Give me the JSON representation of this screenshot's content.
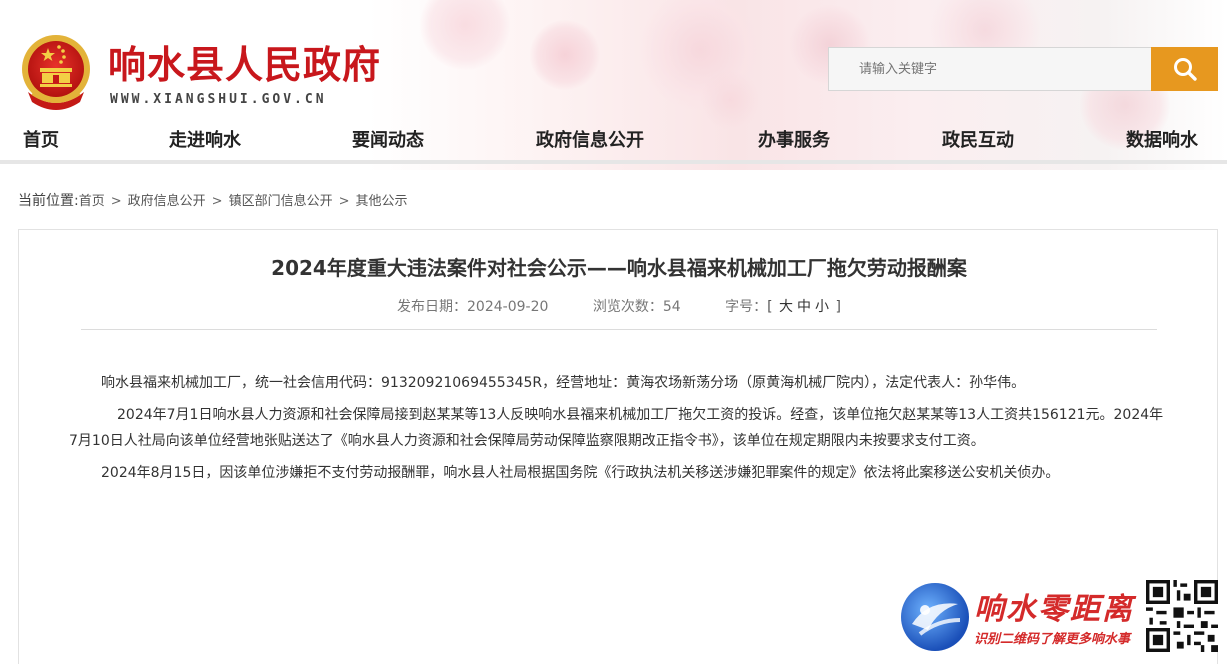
{
  "header": {
    "site_title": "响水县人民政府",
    "site_url": "WWW.XIANGSHUI.GOV.CN",
    "search_placeholder": "请输入关键字"
  },
  "nav": {
    "items": [
      {
        "label": "首页"
      },
      {
        "label": "走进响水"
      },
      {
        "label": "要闻动态"
      },
      {
        "label": "政府信息公开"
      },
      {
        "label": "办事服务"
      },
      {
        "label": "政民互动"
      },
      {
        "label": "数据响水"
      }
    ]
  },
  "breadcrumb": {
    "lead": "当前位置:",
    "items": [
      "首页",
      "政府信息公开",
      "镇区部门信息公开",
      "其他公示"
    ],
    "separator": ">"
  },
  "article": {
    "title": "2024年度重大违法案件对社会公示——响水县福来机械加工厂拖欠劳动报酬案",
    "publish_label": "发布日期：",
    "publish_date": "2024-09-20",
    "views_label": "浏览次数：",
    "views": "54",
    "font_label": "字号：",
    "font_open": "[",
    "font_large": "大",
    "font_medium": "中",
    "font_small": "小",
    "font_close": "]",
    "paragraphs": [
      "响水县福来机械加工厂，统一社会信用代码：91320921069455345R，经营地址：黄海农场新荡分场（原黄海机械厂院内），法定代表人：孙华伟。",
      "2024年7月1日响水县人力资源和社会保障局接到赵某某等13人反映响水县福来机械加工厂拖欠工资的投诉。经查，该单位拖欠赵某某等13人工资共156121元。2024年7月10日人社局向该单位经营地张贴送达了《响水县人力资源和社会保障局劳动保障监察限期改正指令书》，该单位在规定期限内未按要求支付工资。",
      "2024年8月15日，因该单位涉嫌拒不支付劳动报酬罪，响水县人社局根据国务院《行政执法机关移送涉嫌犯罪案件的规定》依法将此案移送公安机关侦办。"
    ]
  },
  "watermark": {
    "title": "响水零距离",
    "subtitle": "识别二维码了解更多响水事"
  },
  "colors": {
    "brand_red": "#c8171c",
    "search_button": "#e7981f",
    "watermark_red": "#d42a2a"
  }
}
